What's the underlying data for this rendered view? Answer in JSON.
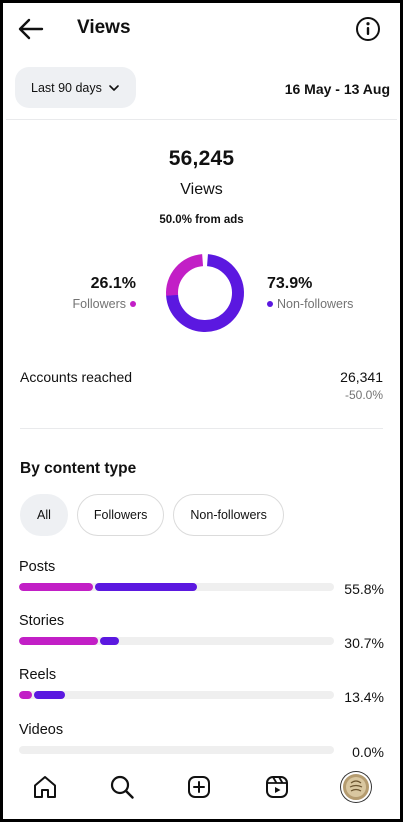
{
  "header": {
    "title": "Views"
  },
  "filter": {
    "range_label": "Last 90 days",
    "date_range": "16 May - 13 Aug"
  },
  "summary": {
    "total": "56,245",
    "total_label": "Views",
    "ads_text": "50.0% from ads",
    "followers_pct": "26.1%",
    "followers_label": "Followers",
    "non_followers_pct": "73.9%",
    "non_followers_label": "Non-followers",
    "followers_fraction": 0.261
  },
  "reach": {
    "label": "Accounts reached",
    "value": "26,341",
    "change": "-50.0%"
  },
  "content": {
    "title": "By content type",
    "chips": [
      "All",
      "Followers",
      "Non-followers"
    ],
    "active_chip": 0,
    "rows": [
      {
        "label": "Posts",
        "pct": "55.8%",
        "followers_fraction": 0.235,
        "non_followers_fraction": 0.325
      },
      {
        "label": "Stories",
        "pct": "30.7%",
        "followers_fraction": 0.25,
        "non_followers_fraction": 0.06
      },
      {
        "label": "Reels",
        "pct": "13.4%",
        "followers_fraction": 0.04,
        "non_followers_fraction": 0.1
      },
      {
        "label": "Videos",
        "pct": "0.0%",
        "followers_fraction": 0,
        "non_followers_fraction": 0
      }
    ]
  },
  "colors": {
    "followers": "#c21fc6",
    "non_followers": "#5b18e0",
    "track": "#efefef"
  },
  "nav": {
    "icons": [
      "home-icon",
      "search-icon",
      "create-icon",
      "reels-icon",
      "profile-avatar"
    ]
  }
}
